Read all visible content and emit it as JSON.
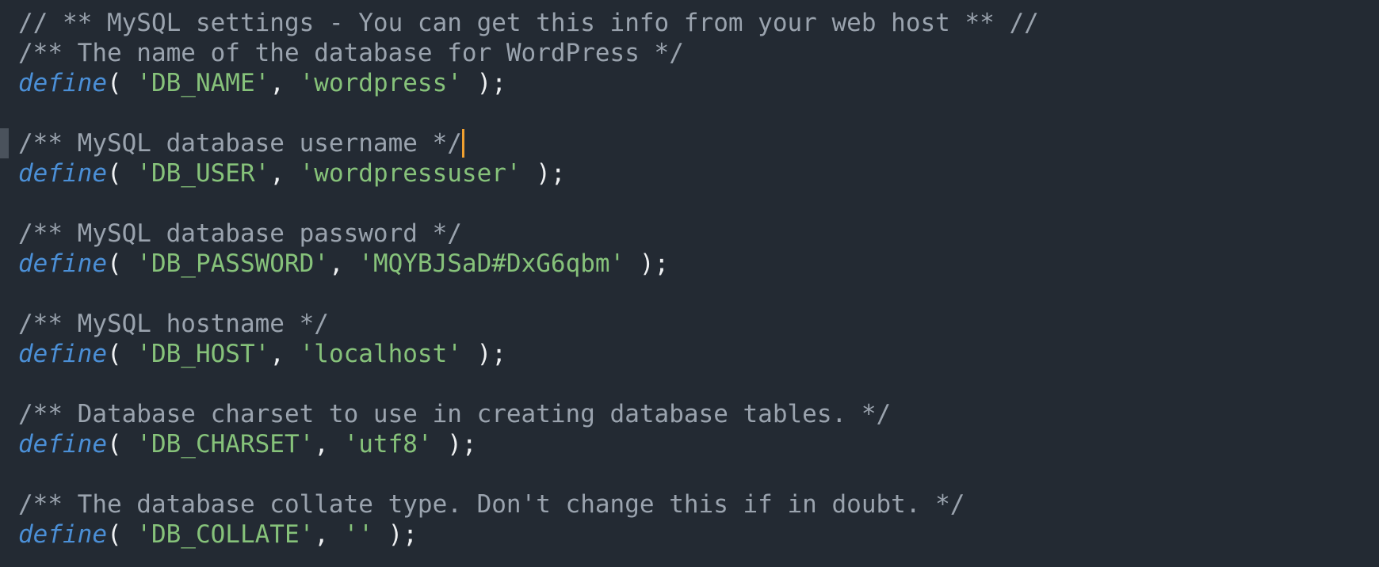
{
  "editor": {
    "lines": [
      {
        "type": "comment",
        "text": "// ** MySQL settings - You can get this info from your web host ** //"
      },
      {
        "type": "comment",
        "text": "/** The name of the database for WordPress */"
      },
      {
        "type": "define",
        "keyword": "define",
        "open": "( ",
        "key": "'DB_NAME'",
        "sep": ", ",
        "value": "'wordpress'",
        "close": " );"
      },
      {
        "type": "empty"
      },
      {
        "type": "comment",
        "text": "/** MySQL database username */",
        "cursor": true
      },
      {
        "type": "define",
        "keyword": "define",
        "open": "( ",
        "key": "'DB_USER'",
        "sep": ", ",
        "value": "'wordpressuser'",
        "close": " );"
      },
      {
        "type": "empty"
      },
      {
        "type": "comment",
        "text": "/** MySQL database password */"
      },
      {
        "type": "define",
        "keyword": "define",
        "open": "( ",
        "key": "'DB_PASSWORD'",
        "sep": ", ",
        "value": "'MQYBJSaD#DxG6qbm'",
        "close": " );"
      },
      {
        "type": "empty"
      },
      {
        "type": "comment",
        "text": "/** MySQL hostname */"
      },
      {
        "type": "define",
        "keyword": "define",
        "open": "( ",
        "key": "'DB_HOST'",
        "sep": ", ",
        "value": "'localhost'",
        "close": " );"
      },
      {
        "type": "empty"
      },
      {
        "type": "comment",
        "text": "/** Database charset to use in creating database tables. */"
      },
      {
        "type": "define",
        "keyword": "define",
        "open": "( ",
        "key": "'DB_CHARSET'",
        "sep": ", ",
        "value": "'utf8'",
        "close": " );"
      },
      {
        "type": "empty"
      },
      {
        "type": "comment",
        "text": "/** The database collate type. Don't change this if in doubt. */"
      },
      {
        "type": "define",
        "keyword": "define",
        "open": "( ",
        "key": "'DB_COLLATE'",
        "sep": ", ",
        "value": "''",
        "close": " );"
      }
    ]
  },
  "colors": {
    "background": "#232a33",
    "comment": "#9aa3ae",
    "keyword": "#4b8fd6",
    "string": "#86c27a",
    "cursor": "#f0a030"
  }
}
